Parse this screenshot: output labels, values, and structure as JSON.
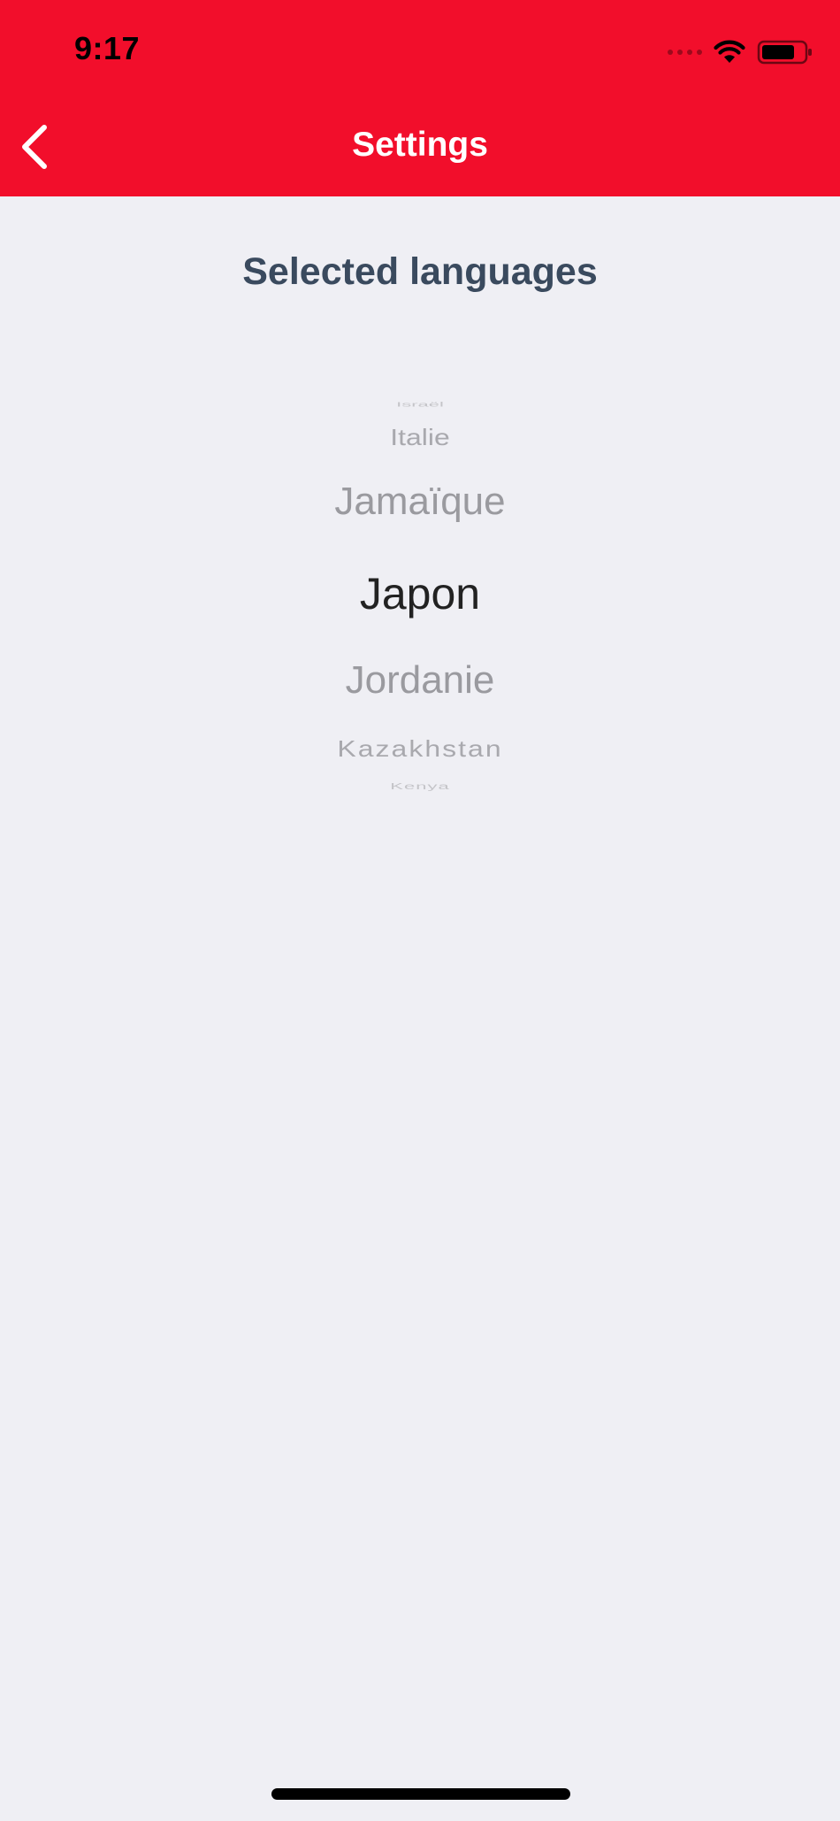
{
  "status_bar": {
    "time": "9:17",
    "icons": [
      "signal-icon",
      "wifi-icon",
      "battery-icon"
    ]
  },
  "nav": {
    "title": "Settings",
    "back_icon": "chevron-left-icon"
  },
  "section": {
    "title": "Selected languages"
  },
  "picker": {
    "items": [
      "Israël",
      "Italie",
      "Jamaïque",
      "Japon",
      "Jordanie",
      "Kazakhstan",
      "Kenya"
    ],
    "selected": "Japon"
  },
  "colors": {
    "header": "#f20e2b",
    "background": "#efeff4",
    "section_title": "#3a4a5e",
    "selected_text": "#222222",
    "unselected_text": "#9a9a9f"
  }
}
